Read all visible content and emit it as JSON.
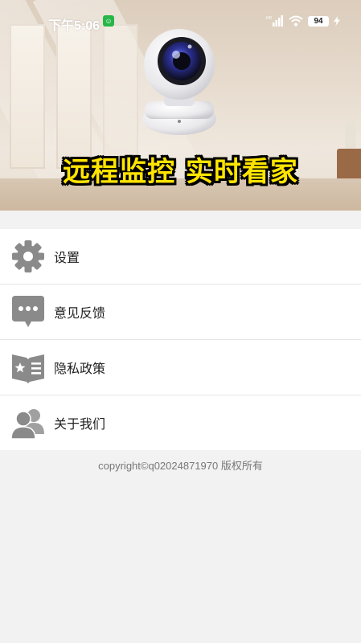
{
  "status_bar": {
    "time": "下午5:06",
    "battery": "94",
    "notification_badge": "☺"
  },
  "banner": {
    "headline": "远程监控 实时看家"
  },
  "menu": {
    "items": [
      {
        "label": "设置",
        "icon": "gear-icon"
      },
      {
        "label": "意见反馈",
        "icon": "chat-bubble-icon"
      },
      {
        "label": "隐私政策",
        "icon": "policy-book-icon"
      },
      {
        "label": "关于我们",
        "icon": "users-icon"
      }
    ]
  },
  "footer": {
    "copyright": "copyright©q02024871970 版权所有"
  },
  "colors": {
    "headline_fill": "#ffe400",
    "icon_gray": "#8a8a8a",
    "status_badge_green": "#27b648"
  }
}
